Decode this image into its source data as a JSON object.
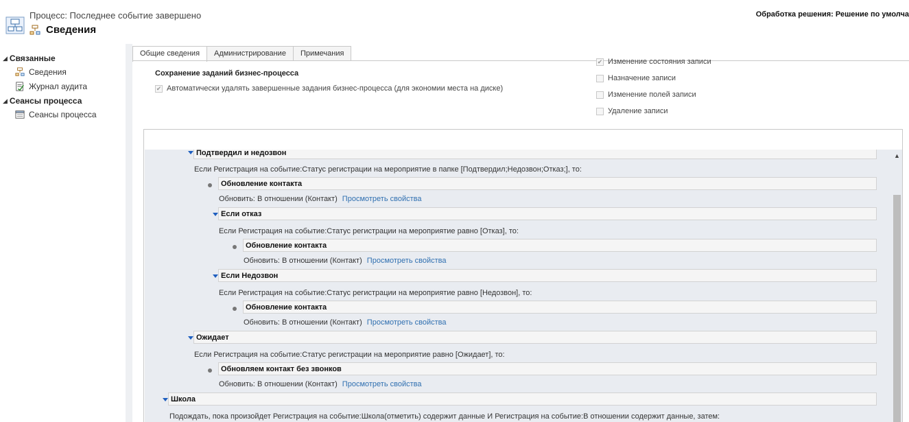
{
  "header": {
    "process_name": "Процесс: Последнее событие завершено",
    "title": "Сведения",
    "solution": "Обработка решения: Решение по умолча"
  },
  "nav": {
    "groups": [
      {
        "label": "Связанные",
        "items": [
          {
            "label": "Сведения",
            "icon": "process-icon"
          },
          {
            "label": "Журнал аудита",
            "icon": "audit-log-icon"
          }
        ]
      },
      {
        "label": "Сеансы процесса",
        "items": [
          {
            "label": "Сеансы процесса",
            "icon": "process-sessions-icon"
          }
        ]
      }
    ]
  },
  "tabs": [
    "Общие сведения",
    "Администрирование",
    "Примечания"
  ],
  "general": {
    "section_title": "Сохранение заданий бизнес-процесса",
    "auto_delete_label": "Автоматически удалять завершенные задания бизнес-процесса (для экономии места на диске)",
    "auto_delete_checked": true,
    "options": [
      {
        "label": "Изменение состояния записи",
        "checked": true
      },
      {
        "label": "Назначение записи",
        "checked": false
      },
      {
        "label": "Изменение полей записи",
        "checked": false
      },
      {
        "label": "Удаление записи",
        "checked": false
      }
    ]
  },
  "designer": {
    "update_prefix": "Обновить:",
    "relation": "В отношении (Контакт)",
    "view_props": "Просмотреть свойства",
    "blocks": {
      "b1_title": "Подтвердил и недозвон",
      "b1_cond": "Если Регистрация на событие:Статус регистрации на мероприятие в папке [Подтвердил;Недозвон;Отказ;], то:",
      "u1_title": "Обновление контакта",
      "b2_title": "Если отказ",
      "b2_cond": "Если Регистрация на событие:Статус регистрации на мероприятие равно [Отказ], то:",
      "u2_title": "Обновление контакта",
      "b3_title": "Если Недозвон",
      "b3_cond": "Если Регистрация на событие:Статус регистрации на мероприятие равно [Недозвон], то:",
      "u3_title": "Обновление контакта",
      "b4_title": "Ожидает",
      "b4_cond": "Если Регистрация на событие:Статус регистрации на мероприятие равно [Ожидает], то:",
      "u4_title": "Обновляем контакт без звонков",
      "b5_title": "Школа",
      "b5_cond": "Подождать, пока произойдет Регистрация на событие:Школа(отметить) содержит данные И Регистрация на событие:В отношении содержит данные, затем:"
    }
  },
  "colors": {
    "link": "#2f6fb0",
    "expander": "#1f5fbf",
    "canvas": "#e9ecf1"
  }
}
